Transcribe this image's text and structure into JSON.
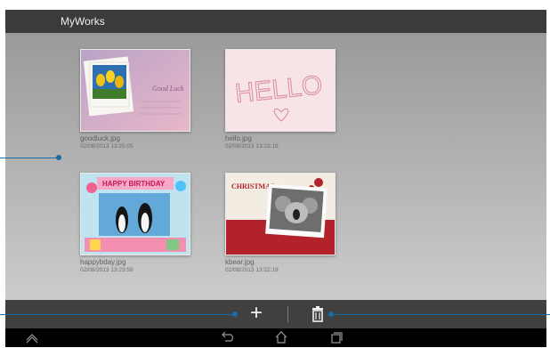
{
  "app": {
    "title": "MyWorks"
  },
  "files": [
    {
      "name": "goodluck.jpg",
      "date": "02/08/2013 13:25:05",
      "thumb_icon": "goodluck-card-thumbnail",
      "thumb_text": "Good Luck"
    },
    {
      "name": "hello.jpg",
      "date": "02/08/2013 13:23:18",
      "thumb_icon": "hello-sketch-thumbnail",
      "thumb_text": "HELLO"
    },
    {
      "name": "happybday.jpg",
      "date": "02/08/2013 13:23:58",
      "thumb_icon": "happy-birthday-card-thumbnail",
      "thumb_text": "HAPPY BIRTHDAY"
    },
    {
      "name": "kbear.jpg",
      "date": "02/08/2013 13:22:19",
      "thumb_icon": "christmas-koala-card-thumbnail",
      "thumb_text": "CHRISTMAS"
    }
  ],
  "actions": {
    "add_icon": "plus-icon",
    "delete_icon": "trash-icon"
  },
  "nav": {
    "menu_icon": "chevron-up-icon",
    "back_icon": "back-icon",
    "home_icon": "home-icon",
    "recents_icon": "recent-apps-icon"
  },
  "colors": {
    "accent": "#1a6aa8",
    "titlebar": "#3b3b3b",
    "actionbar": "#404040",
    "navbar": "#000000"
  }
}
